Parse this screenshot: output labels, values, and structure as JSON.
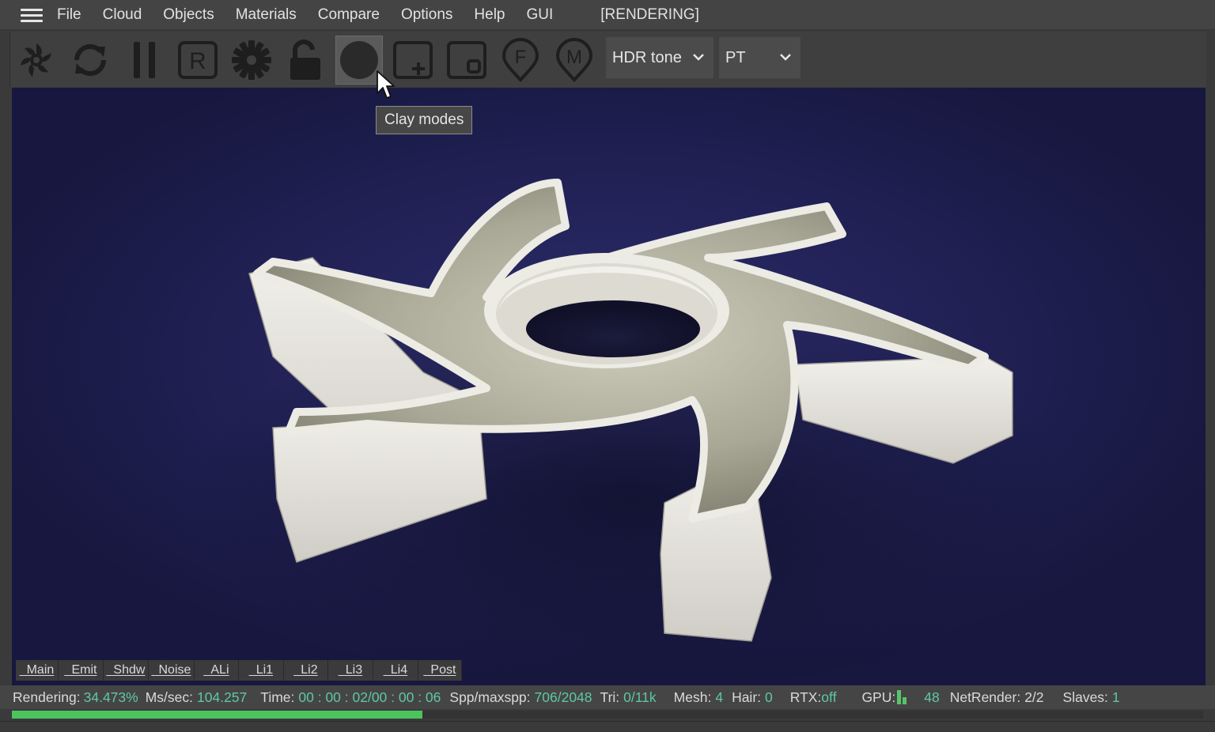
{
  "menu": {
    "items": [
      "File",
      "Cloud",
      "Objects",
      "Materials",
      "Compare",
      "Options",
      "Help",
      "GUI"
    ],
    "status_title": "[RENDERING]"
  },
  "toolbar": {
    "buttons": [
      {
        "icon": "octane-logo-icon"
      },
      {
        "icon": "refresh-icon"
      },
      {
        "icon": "pause-icon"
      },
      {
        "icon": "r-box-icon",
        "letter": "R"
      },
      {
        "icon": "gear-icon"
      },
      {
        "icon": "lock-open-icon"
      },
      {
        "icon": "clay-mode-icon"
      },
      {
        "icon": "plus-box-icon"
      },
      {
        "icon": "region-box-icon"
      },
      {
        "icon": "f-pin-icon",
        "letter": "F"
      },
      {
        "icon": "m-pin-icon",
        "letter": "M"
      }
    ],
    "tone_dropdown": "HDR tone",
    "kernel_dropdown": "PT"
  },
  "tooltip": "Clay modes",
  "pass_tabs": [
    "_Main",
    "_Emit",
    "_Shdw",
    "_Noise",
    "_ALi",
    "_Li1",
    "_Li2",
    "_Li3",
    "_Li4",
    "_Post"
  ],
  "status": {
    "rendering_label": "Rendering:",
    "rendering_value": "34.473%",
    "ms_label": "Ms/sec:",
    "ms_value": "104.257",
    "time_label": "Time:",
    "time_value": "00 : 00 : 02/00 : 00 : 06",
    "spp_label": "Spp/maxspp:",
    "spp_value": "706/2048",
    "tri_label": "Tri:",
    "tri_value": "0/11k",
    "mesh_label": "Mesh:",
    "mesh_value": "4",
    "hair_label": "Hair:",
    "hair_value": "0",
    "rtx_label": "RTX:",
    "rtx_value": "off",
    "gpu_label": "GPU:",
    "gpu_value": "48",
    "netrender_label": "NetRender:",
    "netrender_value": "2/2",
    "slaves_label": "Slaves:",
    "slaves_value": "1"
  },
  "progress": 0.34473,
  "colors": {
    "value_accent": "#5fc7a6",
    "progress": "#4cc45e",
    "viewport_bg": "#23235a"
  }
}
